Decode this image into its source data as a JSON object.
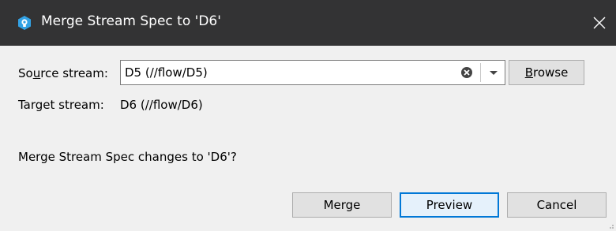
{
  "window": {
    "title": "Merge Stream Spec to 'D6'"
  },
  "icons": {
    "app": "p4v-app-icon",
    "close": "close-icon",
    "clear": "clear-icon",
    "dropdown": "chevron-down-icon"
  },
  "colors": {
    "titlebar_bg": "#333334",
    "dialog_bg": "#f0f0f0",
    "accent": "#0078d7"
  },
  "form": {
    "source_label_prefix": "So",
    "source_label_mnemonic": "u",
    "source_label_suffix": "rce stream:",
    "source_value": "D5 (//flow/D5)",
    "browse_prefix": "",
    "browse_mnemonic": "B",
    "browse_suffix": "rowse",
    "target_label": "Target stream:",
    "target_value": "D6 (//flow/D6)"
  },
  "message": "Merge Stream Spec changes to 'D6'?",
  "buttons": {
    "merge": "Merge",
    "preview": "Preview",
    "cancel": "Cancel"
  }
}
